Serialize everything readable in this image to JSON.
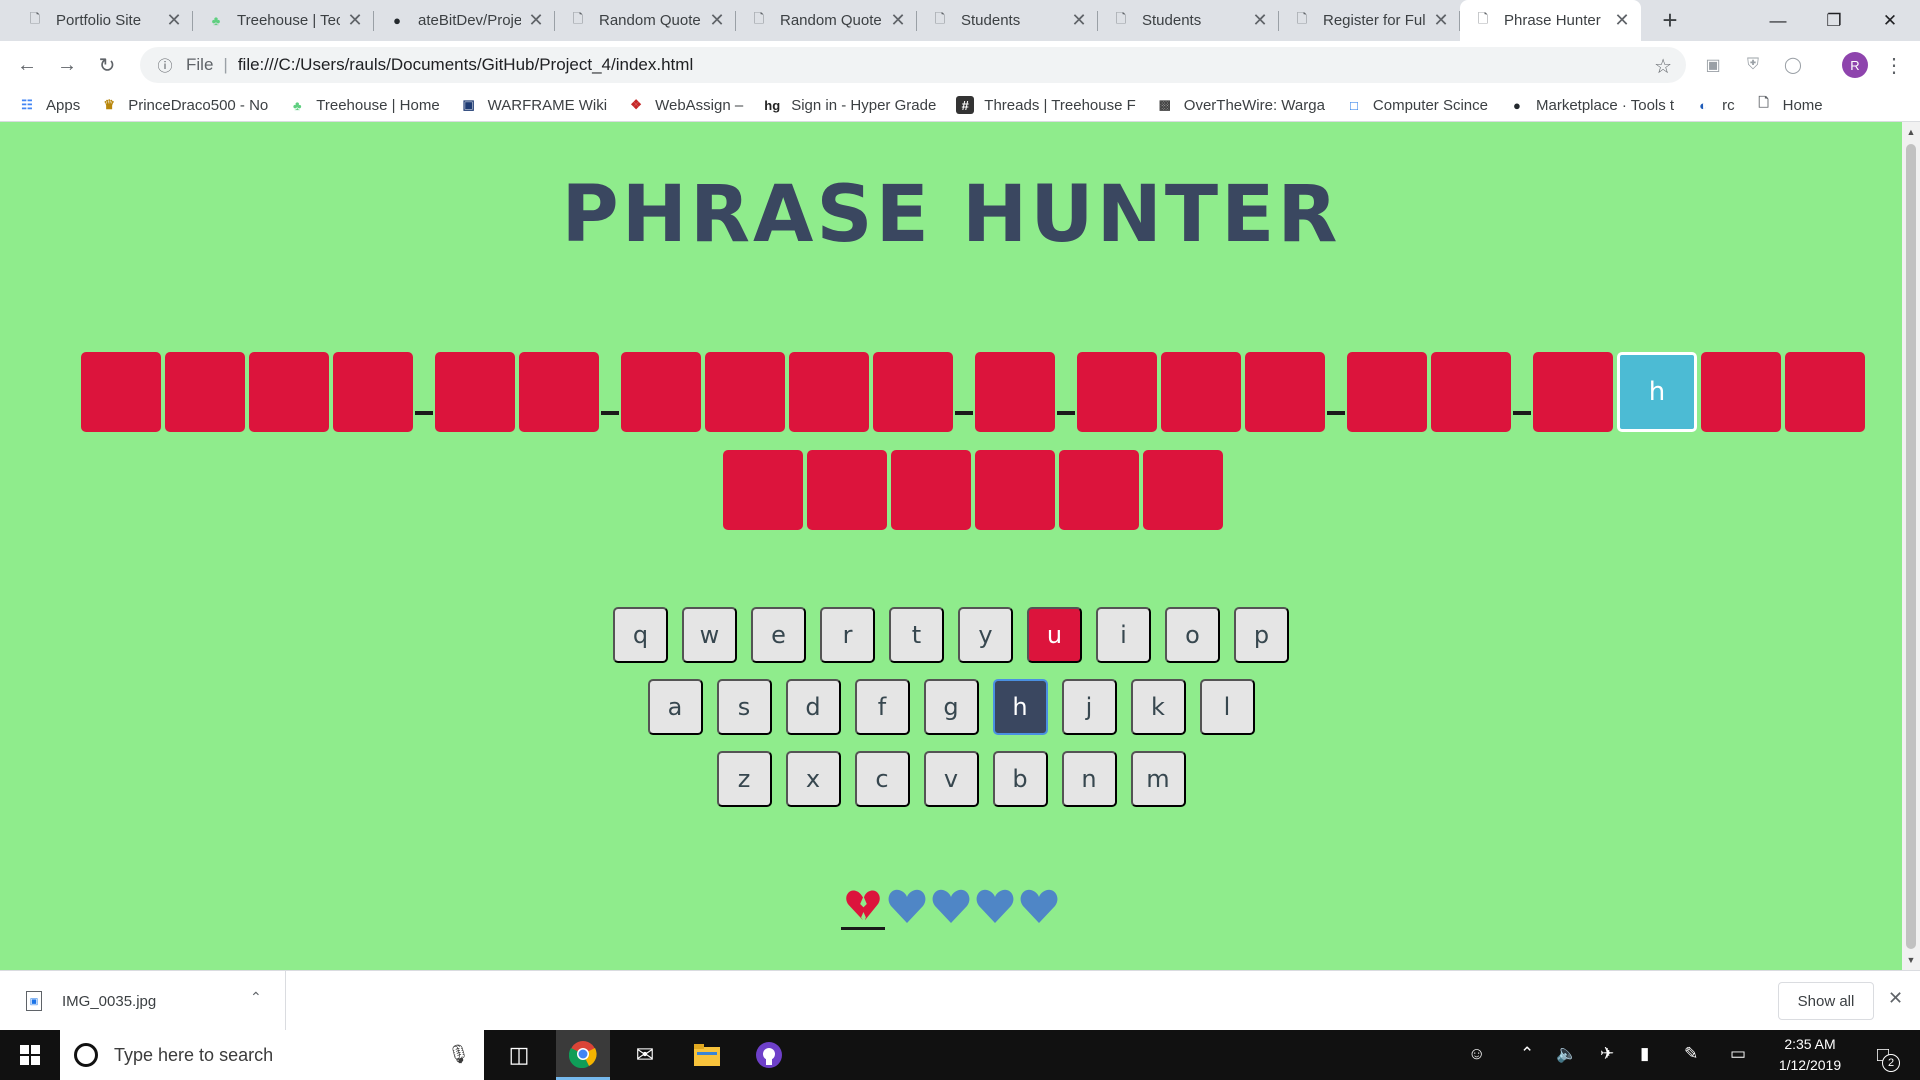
{
  "browser": {
    "tabs": [
      {
        "title": "Portfolio Site",
        "icon": "page-icon",
        "active": false
      },
      {
        "title": "Treehouse | Tec",
        "icon": "treehouse-icon",
        "active": false
      },
      {
        "title": "ateBitDev/Proje",
        "icon": "github-icon",
        "active": false
      },
      {
        "title": "Random Quote",
        "icon": "page-icon",
        "active": false
      },
      {
        "title": "Random Quote",
        "icon": "page-icon",
        "active": false
      },
      {
        "title": "Students",
        "icon": "page-icon",
        "active": false
      },
      {
        "title": "Students",
        "icon": "page-icon",
        "active": false
      },
      {
        "title": "Register for Ful",
        "icon": "page-icon",
        "active": false
      },
      {
        "title": "Phrase Hunter",
        "icon": "page-icon",
        "active": true
      }
    ],
    "address": {
      "scheme_label": "File",
      "url": "file:///C:/Users/rauls/Documents/GitHub/Project_4/index.html"
    },
    "profile_initial": "R",
    "bookmarks": [
      {
        "label": "Apps",
        "icon": "apps-grid-icon"
      },
      {
        "label": "PrinceDraco500 - No",
        "icon": "crown-icon"
      },
      {
        "label": "Treehouse | Home",
        "icon": "treehouse-icon"
      },
      {
        "label": "WARFRAME Wiki",
        "icon": "warframe-icon"
      },
      {
        "label": "WebAssign –",
        "icon": "webassign-icon"
      },
      {
        "label": "Sign in - Hyper Grade",
        "icon": "hg-icon"
      },
      {
        "label": "Threads | Treehouse F",
        "icon": "hash-icon"
      },
      {
        "label": "OverTheWire: Warga",
        "icon": "overthewire-icon"
      },
      {
        "label": "Computer Scince",
        "icon": "bookmark-window-icon"
      },
      {
        "label": "Marketplace · Tools t",
        "icon": "github-icon"
      },
      {
        "label": "rc",
        "icon": "rc-icon"
      },
      {
        "label": "Home",
        "icon": "page-icon"
      }
    ]
  },
  "game": {
    "title": "PHRASE HUNTER",
    "phrase_words": [
      [
        "",
        "",
        "",
        ""
      ],
      [
        "",
        ""
      ],
      [
        "",
        "",
        "",
        ""
      ],
      [
        ""
      ],
      [
        "",
        "",
        ""
      ],
      [
        "",
        ""
      ],
      [
        "",
        "h",
        "",
        ""
      ],
      [
        "",
        "",
        "",
        "",
        "",
        ""
      ]
    ],
    "keyboard_rows": [
      [
        "q",
        "w",
        "e",
        "r",
        "t",
        "y",
        "u",
        "i",
        "o",
        "p"
      ],
      [
        "a",
        "s",
        "d",
        "f",
        "g",
        "h",
        "j",
        "k",
        "l"
      ],
      [
        "z",
        "x",
        "c",
        "v",
        "b",
        "n",
        "m"
      ]
    ],
    "wrong_keys": [
      "u"
    ],
    "chosen_keys": [
      "h"
    ],
    "lives": {
      "lost": 1,
      "remaining": 4
    },
    "colors": {
      "background": "#8fec8c",
      "hidden_letter": "#dc143c",
      "shown_letter": "#4cbbd4",
      "title": "#3a4760",
      "heart": "#4f86c6"
    }
  },
  "downloads": {
    "file": "IMG_0035.jpg",
    "show_all": "Show all"
  },
  "taskbar": {
    "search_placeholder": "Type here to search",
    "time": "2:35 AM",
    "date": "1/12/2019",
    "notification_count": "2"
  }
}
